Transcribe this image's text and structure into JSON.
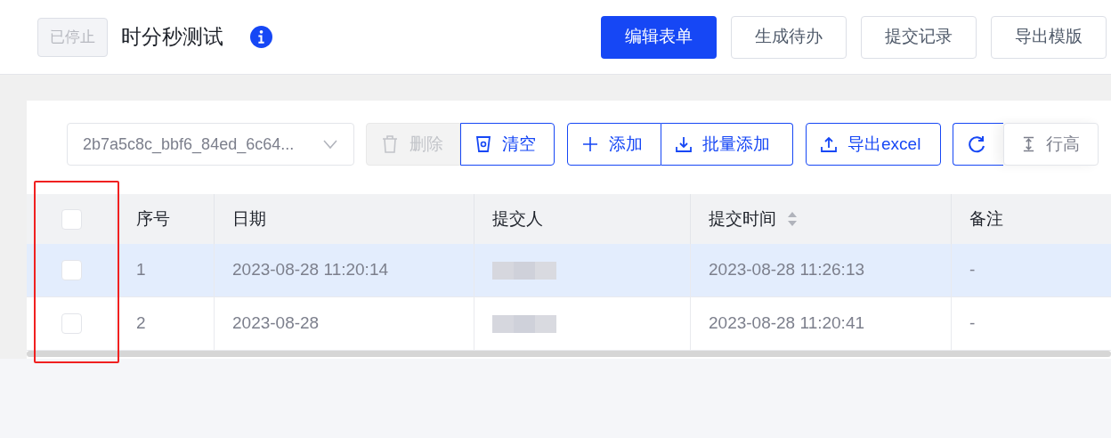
{
  "header": {
    "status_tag": "已停止",
    "title": "时分秒测试",
    "actions": [
      {
        "label": "编辑表单",
        "primary": true
      },
      {
        "label": "生成待办",
        "primary": false
      },
      {
        "label": "提交记录",
        "primary": false
      },
      {
        "label": "导出模版",
        "primary": false
      }
    ]
  },
  "toolbar": {
    "select_value": "2b7a5c8c_bbf6_84ed_6c64...",
    "delete": {
      "label": "删除",
      "disabled": true
    },
    "clear": {
      "label": "清空"
    },
    "add": {
      "label": "添加"
    },
    "batch_add": {
      "label": "批量添加"
    },
    "export": {
      "label": "导出excel"
    },
    "row_height": {
      "label": "行高"
    }
  },
  "table": {
    "header_checked": false,
    "columns": [
      "序号",
      "日期",
      "提交人",
      "提交时间",
      "备注"
    ],
    "rows": [
      {
        "checked": false,
        "highlighted": true,
        "cells": [
          "1",
          "2023-08-28 11:20:14",
          null,
          "2023-08-28 11:26:13",
          "-"
        ]
      },
      {
        "checked": false,
        "highlighted": false,
        "cells": [
          "2",
          "2023-08-28",
          null,
          "2023-08-28 11:20:41",
          "-"
        ]
      }
    ]
  }
}
